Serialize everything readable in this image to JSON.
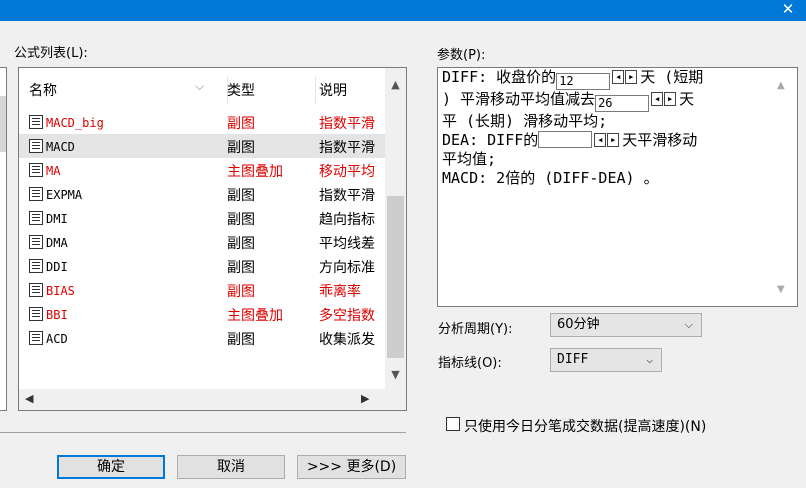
{
  "window": {
    "close_glyph": "✕"
  },
  "left": {
    "list_label": "公式列表(L):",
    "columns": [
      "名称",
      "类型",
      "说明"
    ],
    "sort_glyph": "⌵",
    "rows": [
      {
        "name": "MACD_big",
        "type": "副图",
        "desc": "指数平滑",
        "red": true,
        "selected": false
      },
      {
        "name": "MACD",
        "type": "副图",
        "desc": "指数平滑",
        "red": false,
        "selected": true
      },
      {
        "name": "MA",
        "type": "主图叠加",
        "desc": "移动平均",
        "red": true,
        "selected": false
      },
      {
        "name": "EXPMA",
        "type": "副图",
        "desc": "指数平滑",
        "red": false,
        "selected": false
      },
      {
        "name": "DMI",
        "type": "副图",
        "desc": "趋向指标",
        "red": false,
        "selected": false
      },
      {
        "name": "DMA",
        "type": "副图",
        "desc": "平均线差",
        "red": false,
        "selected": false
      },
      {
        "name": "DDI",
        "type": "副图",
        "desc": "方向标准",
        "red": false,
        "selected": false
      },
      {
        "name": "BIAS",
        "type": "副图",
        "desc": "乖离率",
        "red": true,
        "selected": false
      },
      {
        "name": "BBI",
        "type": "主图叠加",
        "desc": "多空指数",
        "red": true,
        "selected": false
      },
      {
        "name": "ACD",
        "type": "副图",
        "desc": "收集派发",
        "red": false,
        "selected": false
      }
    ],
    "scroll": {
      "up": "▲",
      "down": "▼",
      "left": "◀",
      "right": "▶"
    }
  },
  "buttons": {
    "ok": "确定",
    "cancel": "取消",
    "more": ">>> 更多(D)"
  },
  "params": {
    "label": "参数(P):",
    "line1_a": "DIFF: 收盘价的",
    "diff_short": "12",
    "line1_b": "天 (短期",
    "line2_a": ") 平滑移动平均值减去",
    "diff_long": "26",
    "line2_b": "天",
    "line3": "平 (长期) 滑移动平均;",
    "line4_a": "DEA: DIFF的",
    "dea_days": "",
    "line4_b": "天平滑移动",
    "line5": "平均值;",
    "line6": "MACD: 2倍的 (DIFF-DEA) 。"
  },
  "settings": {
    "period_label": "分析周期(Y):",
    "period_value": "60分钟",
    "line_label": "指标线(O):",
    "line_value": "DIFF",
    "checkbox_label": "只使用今日分笔成交数据(提高速度)(N)"
  }
}
